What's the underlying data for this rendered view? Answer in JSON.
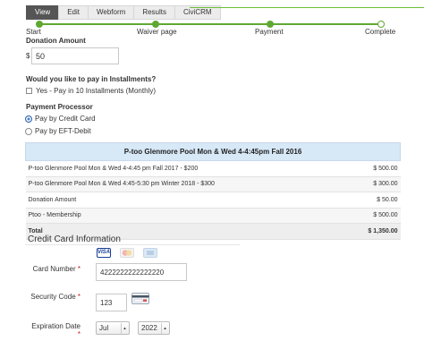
{
  "tabs": [
    {
      "label": "View",
      "active": true
    },
    {
      "label": "Edit",
      "active": false
    },
    {
      "label": "Webform",
      "active": false
    },
    {
      "label": "Results",
      "active": false
    },
    {
      "label": "CiviCRM",
      "active": false
    }
  ],
  "progress": {
    "steps": [
      "Start",
      "Waiver page",
      "Payment",
      "Complete"
    ],
    "color": "#5fa832"
  },
  "donation": {
    "label": "Donation Amount",
    "currency": "$",
    "value": "50"
  },
  "installments": {
    "question": "Would you like to pay in Installments?",
    "option": "Yes - Pay in 10 Installments (Monthly)"
  },
  "payment_processor": {
    "label": "Payment Processor",
    "options": [
      {
        "label": "Pay by Credit Card",
        "selected": true
      },
      {
        "label": "Pay by EFT-Debit",
        "selected": false
      }
    ]
  },
  "line_items": {
    "title": "P-too Glenmore Pool Mon & Wed 4-4:45pm Fall 2016",
    "rows": [
      {
        "desc": "P-too Glenmore Pool Mon & Wed 4-4:45 pm Fall 2017 - $200",
        "amount": "$ 500.00"
      },
      {
        "desc": "P-too Glenmore Pool Mon & Wed 4:45-5:30 pm Winter 2018 - $300",
        "amount": "$ 300.00"
      },
      {
        "desc": "Donation Amount",
        "amount": "$ 50.00"
      },
      {
        "desc": "Ptoo - Membership",
        "amount": "$ 500.00"
      }
    ],
    "total": {
      "desc": "Total",
      "amount": "$ 1,350.00"
    }
  },
  "credit_card": {
    "title": "Credit Card Information",
    "cards": [
      "VISA",
      "mastercard",
      "amex"
    ],
    "number_label": "Card Number",
    "number_value": "4222222222222220",
    "security_label": "Security Code",
    "security_value": "123",
    "expiration_label": "Expiration Date",
    "exp_month": "Jul",
    "exp_year": "2022",
    "required_mark": "*"
  }
}
